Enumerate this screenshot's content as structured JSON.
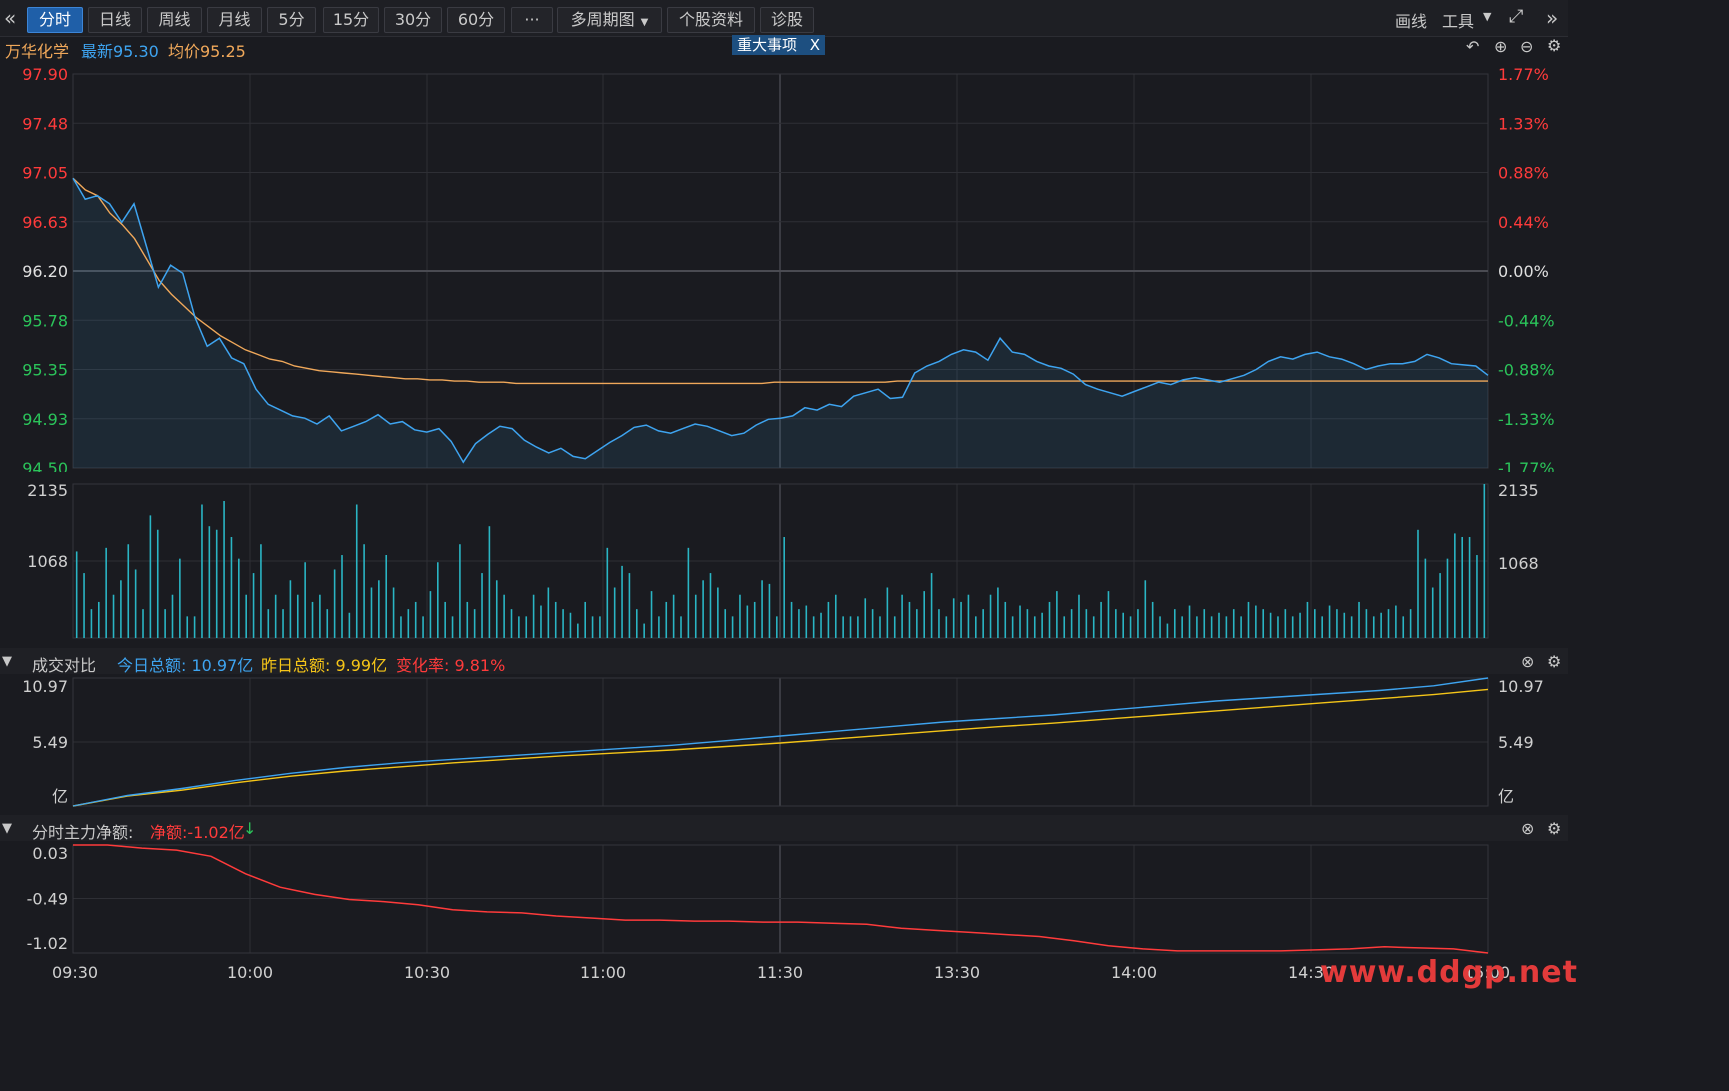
{
  "toolbar": {
    "tabs": [
      "分时",
      "日线",
      "周线",
      "月线",
      "5分",
      "15分",
      "30分",
      "60分",
      "···",
      "多周期图",
      "个股资料",
      "诊股"
    ],
    "draw_label": "画线",
    "tools_label": "工具"
  },
  "stock": {
    "name": "万华化学",
    "latest_label": "最新95.30",
    "avg_label": "均价95.25",
    "event_label": "重大事项",
    "event_close": "X"
  },
  "price_axis": {
    "left": [
      "97.90",
      "97.48",
      "97.05",
      "96.63",
      "96.20",
      "95.78",
      "95.35",
      "94.93",
      "94.50"
    ],
    "right": [
      "1.77%",
      "1.33%",
      "0.88%",
      "0.44%",
      "0.00%",
      "-0.44%",
      "-0.88%",
      "-1.33%",
      "-1.77%"
    ]
  },
  "volume_axis": {
    "left": [
      "2135",
      "1068"
    ],
    "right": [
      "2135",
      "1068"
    ]
  },
  "turnover": {
    "title": "成交对比",
    "today_label": "今日总额: 10.97亿",
    "yesterday_label": "昨日总额: 9.99亿",
    "change_label": "变化率: 9.81%",
    "axis_left": [
      "10.97",
      "5.49",
      "亿"
    ],
    "axis_right": [
      "10.97",
      "5.49",
      "亿"
    ]
  },
  "netflow": {
    "title": "分时主力净额:",
    "net_label": "净额:-1.02亿",
    "axis_left": [
      "0.03",
      "-0.49",
      "-1.02"
    ]
  },
  "time_axis": [
    "09:30",
    "10:00",
    "10:30",
    "11:00",
    "11:30",
    "13:30",
    "14:00",
    "14:30",
    "15:00"
  ],
  "watermark": "www.ddgp.net",
  "colors": {
    "up": "#ff3b3b",
    "down": "#2bc45a",
    "price_line": "#3ea4f0",
    "avg_line": "#f0a85a",
    "turnover_today": "#3ea4f0",
    "turnover_yesterday": "#f5c518",
    "netflow": "#ff3b3b"
  },
  "chart_data": [
    {
      "type": "line",
      "title": "",
      "series": [
        {
          "name": "最新",
          "values": [
            97.0,
            96.82,
            96.85,
            96.78,
            96.62,
            96.78,
            96.42,
            96.06,
            96.25,
            96.18,
            95.8,
            95.55,
            95.62,
            95.45,
            95.4,
            95.18,
            95.05,
            95.0,
            94.95,
            94.93,
            94.88,
            94.95,
            94.82,
            94.86,
            94.9,
            94.96,
            94.88,
            94.9,
            94.83,
            94.81,
            94.84,
            94.73,
            94.55,
            94.71,
            94.79,
            94.86,
            94.84,
            94.74,
            94.68,
            94.63,
            94.67,
            94.6,
            94.58,
            94.65,
            94.72,
            94.78,
            94.85,
            94.87,
            94.82,
            94.8,
            94.84,
            94.88,
            94.86,
            94.82,
            94.78,
            94.8,
            94.87,
            94.92,
            94.93,
            94.95,
            95.02,
            95.0,
            95.05,
            95.03,
            95.12,
            95.15,
            95.18,
            95.1,
            95.11,
            95.32,
            95.38,
            95.42,
            95.48,
            95.52,
            95.5,
            95.43,
            95.62,
            95.5,
            95.48,
            95.42,
            95.38,
            95.36,
            95.31,
            95.22,
            95.18,
            95.15,
            95.12,
            95.16,
            95.2,
            95.24,
            95.22,
            95.26,
            95.28,
            95.26,
            95.24,
            95.27,
            95.3,
            95.35,
            95.42,
            95.46,
            95.44,
            95.48,
            95.5,
            95.46,
            95.44,
            95.4,
            95.35,
            95.38,
            95.4,
            95.4,
            95.42,
            95.48,
            95.45,
            95.4,
            95.39,
            95.38,
            95.3
          ]
        },
        {
          "name": "均价",
          "values": [
            97.0,
            96.9,
            96.85,
            96.7,
            96.6,
            96.48,
            96.3,
            96.12,
            96.0,
            95.9,
            95.8,
            95.72,
            95.64,
            95.58,
            95.52,
            95.48,
            95.44,
            95.42,
            95.38,
            95.36,
            95.34,
            95.33,
            95.32,
            95.31,
            95.3,
            95.29,
            95.28,
            95.27,
            95.27,
            95.26,
            95.26,
            95.25,
            95.25,
            95.24,
            95.24,
            95.24,
            95.23,
            95.23,
            95.23,
            95.23,
            95.23,
            95.23,
            95.23,
            95.23,
            95.23,
            95.23,
            95.23,
            95.23,
            95.23,
            95.23,
            95.23,
            95.23,
            95.23,
            95.23,
            95.23,
            95.23,
            95.23,
            95.24,
            95.24,
            95.24,
            95.24,
            95.24,
            95.24,
            95.24,
            95.24,
            95.24,
            95.24,
            95.25,
            95.25,
            95.25,
            95.25,
            95.25,
            95.25,
            95.25,
            95.25,
            95.25,
            95.25,
            95.25,
            95.25,
            95.25,
            95.25,
            95.25,
            95.25,
            95.25,
            95.25,
            95.25,
            95.25,
            95.25,
            95.25,
            95.25,
            95.25,
            95.25,
            95.25,
            95.25,
            95.25,
            95.25,
            95.25,
            95.25,
            95.25,
            95.25,
            95.25,
            95.25,
            95.25,
            95.25,
            95.25,
            95.25,
            95.25,
            95.25,
            95.25,
            95.25,
            95.25,
            95.25,
            95.25,
            95.25,
            95.25,
            95.25
          ]
        }
      ],
      "ylim": [
        94.5,
        97.9
      ],
      "reference": 96.2
    },
    {
      "type": "bar",
      "title": "",
      "ylim": [
        0,
        2135
      ],
      "values": [
        1200,
        900,
        400,
        500,
        1250,
        600,
        800,
        1300,
        950,
        400,
        1700,
        1500,
        400,
        600,
        1100,
        300,
        300,
        1850,
        1550,
        1500,
        1900,
        1400,
        1100,
        600,
        900,
        1300,
        400,
        600,
        400,
        800,
        600,
        1050,
        500,
        600,
        400,
        950,
        1150,
        350,
        1850,
        1300,
        700,
        800,
        1150,
        700,
        300,
        400,
        500,
        300,
        650,
        1050,
        500,
        300,
        1300,
        500,
        400,
        900,
        1550,
        800,
        600,
        400,
        300,
        300,
        600,
        450,
        700,
        500,
        400,
        350,
        200,
        500,
        300,
        300,
        1250,
        700,
        1000,
        900,
        400,
        200,
        650,
        300,
        500,
        600,
        300,
        1250,
        600,
        800,
        900,
        700,
        400,
        300,
        600,
        450,
        500,
        800,
        750,
        300,
        1400,
        500,
        400,
        450,
        300,
        350,
        500,
        600,
        300,
        300,
        300,
        550,
        400,
        300,
        700,
        300,
        600,
        500,
        400,
        650,
        900,
        400,
        300,
        550,
        500,
        600,
        300,
        400,
        600,
        700,
        500,
        300,
        450,
        400,
        300,
        350,
        500,
        650,
        300,
        400,
        600,
        400,
        300,
        500,
        650,
        400,
        350,
        300,
        400,
        800,
        500,
        300,
        200,
        400,
        300,
        450,
        300,
        400,
        300,
        350,
        300,
        400,
        300,
        500,
        450,
        400,
        350,
        300,
        400,
        300,
        350,
        500,
        400,
        300,
        450,
        400,
        350,
        300,
        500,
        400,
        300,
        350,
        400,
        450,
        300,
        400,
        1500,
        1100,
        700,
        900,
        1100,
        1450,
        1400,
        1400,
        1150,
        2135
      ]
    },
    {
      "type": "line",
      "title": "",
      "ylim": [
        0,
        10.97
      ],
      "series": [
        {
          "name": "今日总额",
          "values": [
            0,
            0.9,
            1.5,
            2.2,
            2.8,
            3.3,
            3.7,
            4.0,
            4.3,
            4.6,
            4.9,
            5.2,
            5.6,
            6.0,
            6.4,
            6.8,
            7.2,
            7.5,
            7.8,
            8.2,
            8.6,
            9.0,
            9.3,
            9.6,
            9.9,
            10.3,
            10.97
          ]
        },
        {
          "name": "昨日总额",
          "values": [
            0,
            0.85,
            1.35,
            2.0,
            2.55,
            3.0,
            3.35,
            3.7,
            4.0,
            4.3,
            4.55,
            4.8,
            5.1,
            5.4,
            5.75,
            6.1,
            6.45,
            6.8,
            7.1,
            7.45,
            7.8,
            8.15,
            8.5,
            8.85,
            9.2,
            9.55,
            9.99
          ]
        }
      ]
    },
    {
      "type": "line",
      "title": "",
      "ylim": [
        -1.02,
        0.03
      ],
      "series": [
        {
          "name": "净额",
          "values": [
            0.03,
            0.03,
            0.0,
            -0.02,
            -0.08,
            -0.25,
            -0.38,
            -0.45,
            -0.5,
            -0.52,
            -0.55,
            -0.6,
            -0.62,
            -0.63,
            -0.66,
            -0.68,
            -0.7,
            -0.7,
            -0.71,
            -0.71,
            -0.72,
            -0.72,
            -0.73,
            -0.74,
            -0.78,
            -0.8,
            -0.82,
            -0.84,
            -0.86,
            -0.9,
            -0.95,
            -0.98,
            -1.0,
            -1.0,
            -1.0,
            -1.0,
            -0.99,
            -0.98,
            -0.96,
            -0.97,
            -0.98,
            -1.02
          ]
        }
      ]
    }
  ]
}
